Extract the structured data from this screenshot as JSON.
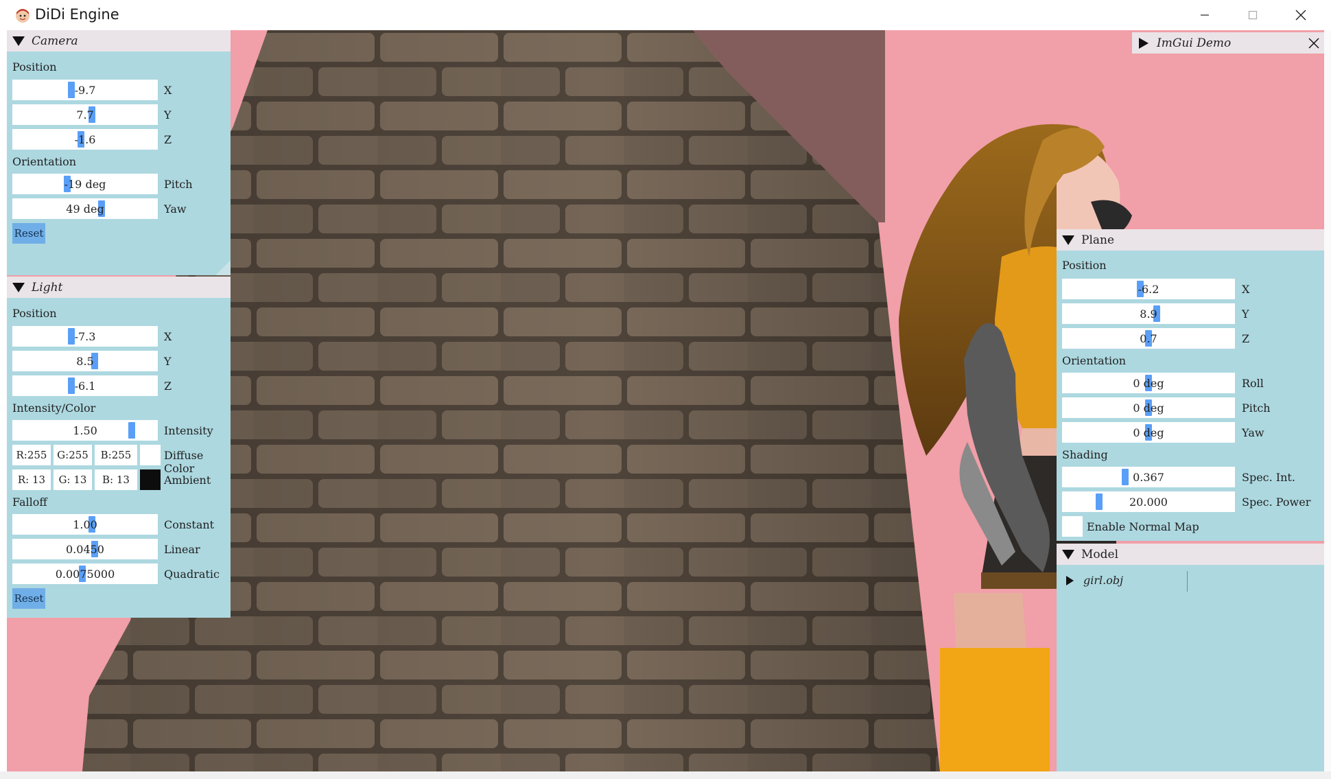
{
  "window": {
    "title": "DiDi Engine",
    "icon": "app-avatar-icon"
  },
  "colors": {
    "viewport_bg": "#f19fa8",
    "panel_bg": "#add8e0",
    "header_bg": "#eae4e8",
    "grab": "#5a9ff7",
    "button": "#70aee8"
  },
  "camera": {
    "title": "Camera",
    "position_label": "Position",
    "pos_x": {
      "value": "-9.7",
      "label": "X",
      "ratio": 0.4
    },
    "pos_y": {
      "value": "7.7",
      "label": "Y",
      "ratio": 0.55
    },
    "pos_z": {
      "value": "-1.6",
      "label": "Z",
      "ratio": 0.47
    },
    "orientation_label": "Orientation",
    "pitch": {
      "value": "-19 deg",
      "label": "Pitch",
      "ratio": 0.37
    },
    "yaw": {
      "value": "49 deg",
      "label": "Yaw",
      "ratio": 0.62
    },
    "reset": "Reset"
  },
  "light": {
    "title": "Light",
    "position_label": "Position",
    "pos_x": {
      "value": "-7.3",
      "label": "X",
      "ratio": 0.4
    },
    "pos_y": {
      "value": "8.5",
      "label": "Y",
      "ratio": 0.57
    },
    "pos_z": {
      "value": "-6.1",
      "label": "Z",
      "ratio": 0.4
    },
    "intensity_color_label": "Intensity/Color",
    "intensity": {
      "value": "1.50",
      "label": "Intensity",
      "ratio": 0.84
    },
    "diffuse": {
      "r": "R:255",
      "g": "G:255",
      "b": "B:255",
      "label": "Diffuse Color",
      "swatch": "#ffffff"
    },
    "ambient": {
      "r": "R: 13",
      "g": "G: 13",
      "b": "B: 13",
      "label": "Ambient",
      "swatch": "#0d0d0d"
    },
    "falloff_label": "Falloff",
    "constant": {
      "value": "1.00",
      "label": "Constant",
      "ratio": 0.55
    },
    "linear": {
      "value": "0.0450",
      "label": "Linear",
      "ratio": 0.57
    },
    "quadratic": {
      "value": "0.0075000",
      "label": "Quadratic",
      "ratio": 0.48
    },
    "reset": "Reset"
  },
  "imgui_demo": {
    "title": "ImGui Demo"
  },
  "plane": {
    "title": "Plane",
    "position_label": "Position",
    "pos_x": {
      "value": "-6.2",
      "label": "X",
      "ratio": 0.45
    },
    "pos_y": {
      "value": "8.9",
      "label": "Y",
      "ratio": 0.55
    },
    "pos_z": {
      "value": "0.7",
      "label": "Z",
      "ratio": 0.5
    },
    "orientation_label": "Orientation",
    "roll": {
      "value": "0 deg",
      "label": "Roll",
      "ratio": 0.5
    },
    "pitch": {
      "value": "0 deg",
      "label": "Pitch",
      "ratio": 0.5
    },
    "yaw": {
      "value": "0 deg",
      "label": "Yaw",
      "ratio": 0.5
    },
    "shading_label": "Shading",
    "spec_int": {
      "value": "0.367",
      "label": "Spec. Int.",
      "ratio": 0.36
    },
    "spec_power": {
      "value": "20.000",
      "label": "Spec. Power",
      "ratio": 0.2
    },
    "normal_map": {
      "label": "Enable Normal Map",
      "checked": false
    }
  },
  "model": {
    "title": "Model",
    "items": [
      {
        "label": "girl.obj"
      }
    ]
  }
}
